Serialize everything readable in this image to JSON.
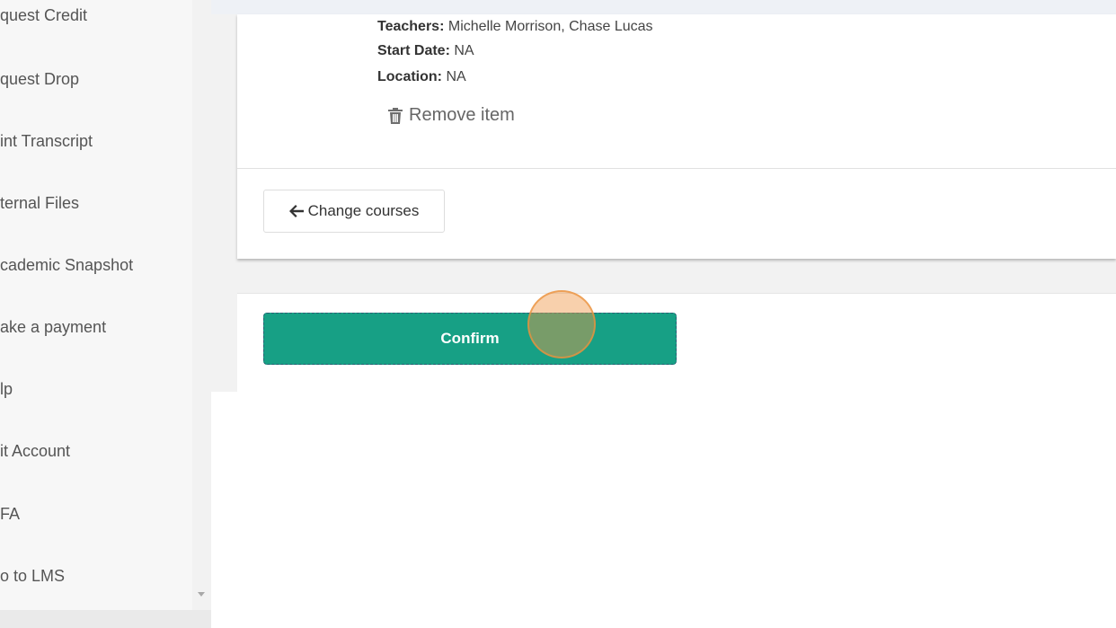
{
  "sidebar": {
    "items": [
      {
        "label": "quest Credit"
      },
      {
        "label": "quest Drop"
      },
      {
        "label": "int Transcript"
      },
      {
        "label": "ternal Files"
      },
      {
        "label": "cademic Snapshot"
      },
      {
        "label": "ake a payment"
      },
      {
        "label": "lp"
      },
      {
        "label": "it Account"
      },
      {
        "label": "FA"
      },
      {
        "label": "o to LMS"
      }
    ]
  },
  "course": {
    "teachers_label": "Teachers:",
    "teachers_value": "Michelle Morrison, Chase Lucas",
    "start_date_label": "Start Date:",
    "start_date_value": "NA",
    "location_label": "Location:",
    "location_value": "NA",
    "remove_item_label": "Remove item",
    "remove_icon": "trash-icon"
  },
  "actions": {
    "change_courses_label": "Change courses",
    "change_courses_icon": "arrow-left-icon",
    "confirm_label": "Confirm"
  },
  "colors": {
    "confirm_bg": "#17a085",
    "confirm_border": "#2b5f74",
    "sidebar_bg": "#f7f7f7",
    "page_bg": "#f2f2f2",
    "click_marker": "#f0964a"
  }
}
